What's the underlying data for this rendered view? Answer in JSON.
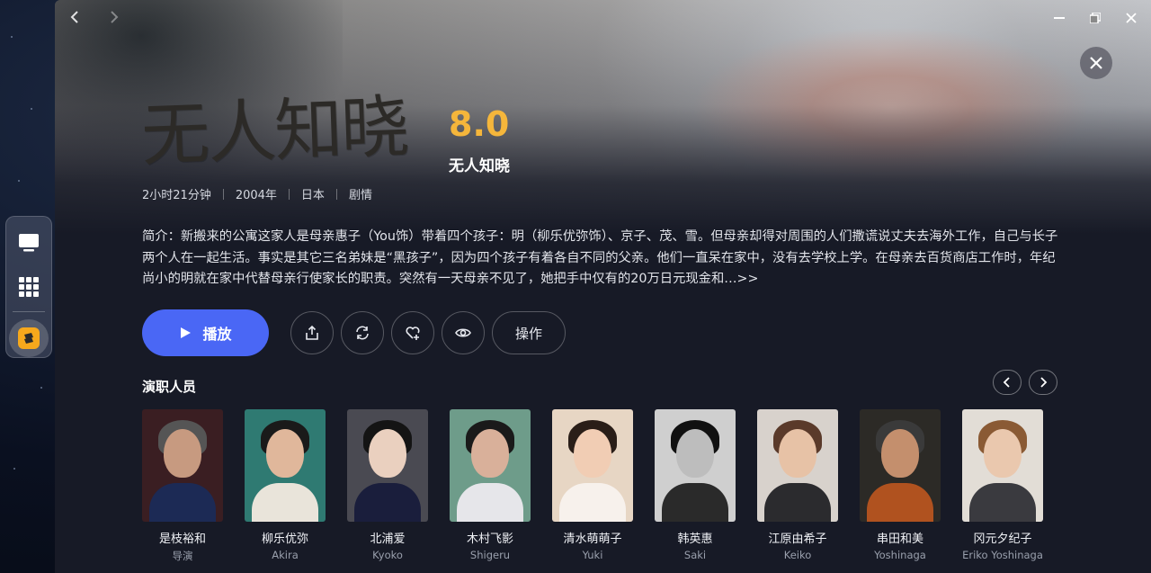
{
  "window": {
    "title_art": "无人知晓",
    "rating": "8.0",
    "title": "无人知晓"
  },
  "meta": [
    "2小时21分钟",
    "2004年",
    "日本",
    "剧情"
  ],
  "synopsis": "简介：新搬来的公寓这家人是母亲惠子（You饰）带着四个孩子：明（柳乐优弥饰）、京子、茂、雪。但母亲却得对周围的人们撒谎说丈夫去海外工作，自己与长子两个人在一起生活。事实是其它三名弟妹是“黑孩子”，因为四个孩子有着各自不同的父亲。他们一直呆在家中，没有去学校上学。在母亲去百货商店工作时，年纪尚小的明就在家中代替母亲行使家长的职责。突然有一天母亲不见了，她把手中仅有的20万日元现金和…>>",
  "actions": {
    "play_label": "播放",
    "operate_label": "操作"
  },
  "cast_section_title": "演职人员",
  "cast": [
    {
      "name": "是枝裕和",
      "role": "导演"
    },
    {
      "name": "柳乐优弥",
      "role": "Akira"
    },
    {
      "name": "北浦爱",
      "role": "Kyoko"
    },
    {
      "name": "木村飞影",
      "role": "Shigeru"
    },
    {
      "name": "清水萌萌子",
      "role": "Yuki"
    },
    {
      "name": "韩英惠",
      "role": "Saki"
    },
    {
      "name": "江原由希子",
      "role": "Keiko"
    },
    {
      "name": "串田和美",
      "role": "Yoshinaga"
    },
    {
      "name": "冈元夕纪子",
      "role": "Eriko Yoshinaga"
    }
  ],
  "colors": {
    "accent": "#4a67f5",
    "rating": "#f5b63b",
    "background": "#171a26"
  }
}
